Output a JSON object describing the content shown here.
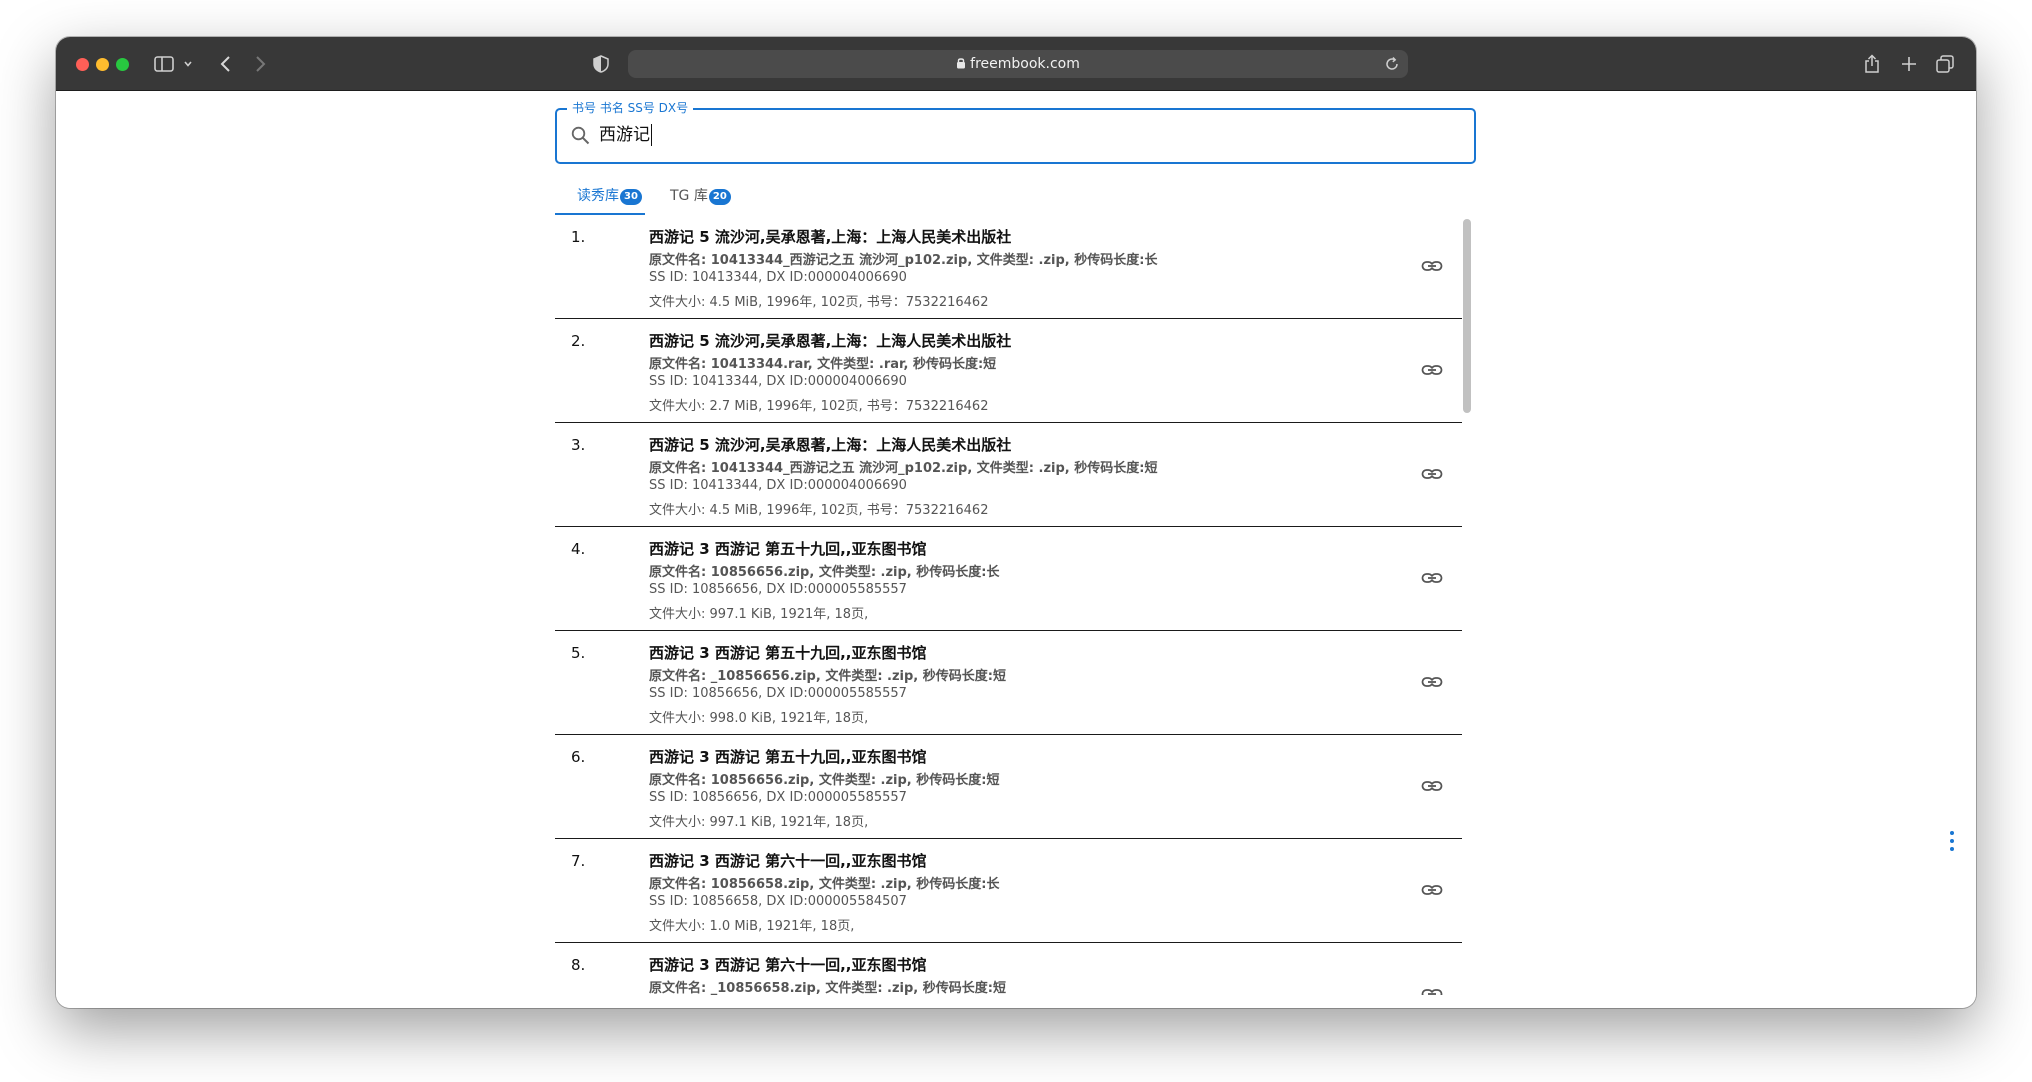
{
  "browser": {
    "url": "freembook.com"
  },
  "search": {
    "label": "书号 书名 SS号 DX号",
    "value": "西游记"
  },
  "tabs": [
    {
      "label": "读秀库",
      "count": "30"
    },
    {
      "label": "TG 库",
      "count": "20"
    }
  ],
  "results": [
    {
      "num": "1.",
      "title": "西游记 5 流沙河,吴承恩著,上海：上海人民美术出版社",
      "file": "原文件名: 10413344_西游记之五 流沙河_p102.zip, 文件类型: .zip, 秒传码长度:长",
      "ids": "SS ID: 10413344, DX ID:000004006690",
      "meta": "文件大小: 4.5 MiB, 1996年, 102页, 书号：7532216462"
    },
    {
      "num": "2.",
      "title": "西游记 5 流沙河,吴承恩著,上海：上海人民美术出版社",
      "file": "原文件名: 10413344.rar, 文件类型: .rar, 秒传码长度:短",
      "ids": "SS ID: 10413344, DX ID:000004006690",
      "meta": "文件大小: 2.7 MiB, 1996年, 102页, 书号：7532216462"
    },
    {
      "num": "3.",
      "title": "西游记 5 流沙河,吴承恩著,上海：上海人民美术出版社",
      "file": "原文件名: 10413344_西游记之五 流沙河_p102.zip, 文件类型: .zip, 秒传码长度:短",
      "ids": "SS ID: 10413344, DX ID:000004006690",
      "meta": "文件大小: 4.5 MiB, 1996年, 102页, 书号：7532216462"
    },
    {
      "num": "4.",
      "title": "西游记 3 西游记 第五十九回,,亚东图书馆",
      "file": "原文件名: 10856656.zip, 文件类型: .zip, 秒传码长度:长",
      "ids": "SS ID: 10856656, DX ID:000005585557",
      "meta": "文件大小: 997.1 KiB, 1921年, 18页,"
    },
    {
      "num": "5.",
      "title": "西游记 3 西游记 第五十九回,,亚东图书馆",
      "file": "原文件名: _10856656.zip, 文件类型: .zip, 秒传码长度:短",
      "ids": "SS ID: 10856656, DX ID:000005585557",
      "meta": "文件大小: 998.0 KiB, 1921年, 18页,"
    },
    {
      "num": "6.",
      "title": "西游记 3 西游记 第五十九回,,亚东图书馆",
      "file": "原文件名: 10856656.zip, 文件类型: .zip, 秒传码长度:短",
      "ids": "SS ID: 10856656, DX ID:000005585557",
      "meta": "文件大小: 997.1 KiB, 1921年, 18页,"
    },
    {
      "num": "7.",
      "title": "西游记 3 西游记 第六十一回,,亚东图书馆",
      "file": "原文件名: 10856658.zip, 文件类型: .zip, 秒传码长度:长",
      "ids": "SS ID: 10856658, DX ID:000005584507",
      "meta": "文件大小: 1.0 MiB, 1921年, 18页,"
    },
    {
      "num": "8.",
      "title": "西游记 3 西游记 第六十一回,,亚东图书馆",
      "file": "原文件名: _10856658.zip, 文件类型: .zip, 秒传码长度:短",
      "ids": "",
      "meta": ""
    }
  ],
  "colors": {
    "accent": "#1976d2",
    "toolbar": "#383838"
  }
}
